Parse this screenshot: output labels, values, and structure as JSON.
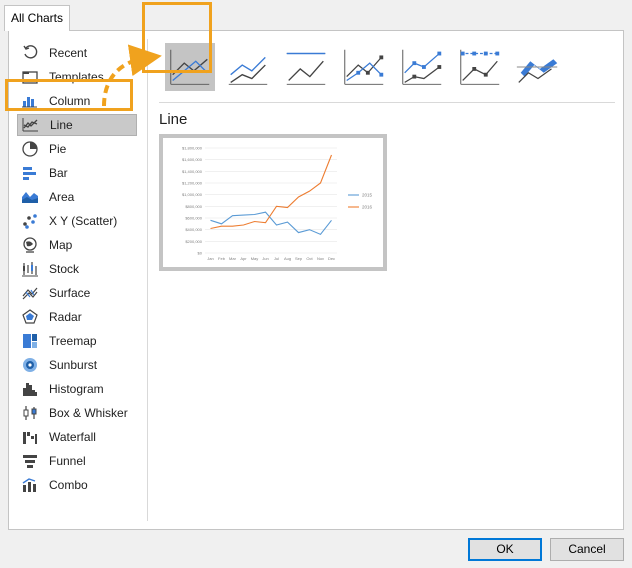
{
  "tab": {
    "label": "All Charts"
  },
  "sidebar": {
    "items": [
      {
        "label": "Recent",
        "icon": "recent-icon"
      },
      {
        "label": "Templates",
        "icon": "templates-icon"
      },
      {
        "label": "Column",
        "icon": "column-chart-icon"
      },
      {
        "label": "Line",
        "icon": "line-chart-icon",
        "selected": true
      },
      {
        "label": "Pie",
        "icon": "pie-chart-icon"
      },
      {
        "label": "Bar",
        "icon": "bar-chart-icon"
      },
      {
        "label": "Area",
        "icon": "area-chart-icon"
      },
      {
        "label": "X Y (Scatter)",
        "icon": "scatter-chart-icon"
      },
      {
        "label": "Map",
        "icon": "map-chart-icon"
      },
      {
        "label": "Stock",
        "icon": "stock-chart-icon"
      },
      {
        "label": "Surface",
        "icon": "surface-chart-icon"
      },
      {
        "label": "Radar",
        "icon": "radar-chart-icon"
      },
      {
        "label": "Treemap",
        "icon": "treemap-chart-icon"
      },
      {
        "label": "Sunburst",
        "icon": "sunburst-chart-icon"
      },
      {
        "label": "Histogram",
        "icon": "histogram-chart-icon"
      },
      {
        "label": "Box & Whisker",
        "icon": "box-whisker-chart-icon"
      },
      {
        "label": "Waterfall",
        "icon": "waterfall-chart-icon"
      },
      {
        "label": "Funnel",
        "icon": "funnel-chart-icon"
      },
      {
        "label": "Combo",
        "icon": "combo-chart-icon"
      }
    ]
  },
  "subtypes": [
    {
      "icon": "line-subtype-icon",
      "selected": true
    },
    {
      "icon": "stacked-line-subtype-icon"
    },
    {
      "icon": "100-stacked-line-subtype-icon"
    },
    {
      "icon": "line-with-markers-subtype-icon"
    },
    {
      "icon": "stacked-line-with-markers-subtype-icon"
    },
    {
      "icon": "100-stacked-line-with-markers-subtype-icon"
    },
    {
      "icon": "3d-line-subtype-icon"
    }
  ],
  "main": {
    "subtitle": "Line"
  },
  "colors": {
    "accent_highlight": "#f0a21e",
    "series_2015": "#5b9bd5",
    "series_2016": "#ed7d31"
  },
  "chart_data": {
    "type": "line",
    "categories": [
      "Jan",
      "Feb",
      "Mar",
      "Apr",
      "May",
      "Jun",
      "Jul",
      "Aug",
      "Sep",
      "Oct",
      "Nov",
      "Dec"
    ],
    "series": [
      {
        "name": "2015",
        "values": [
          560000,
          500000,
          640000,
          650000,
          660000,
          700000,
          480000,
          530000,
          350000,
          400000,
          320000,
          560000
        ]
      },
      {
        "name": "2016",
        "values": [
          420000,
          460000,
          460000,
          480000,
          540000,
          520000,
          800000,
          780000,
          960000,
          1060000,
          1200000,
          1680000
        ]
      }
    ],
    "ytick_labels": [
      "$1,800,000",
      "$1,600,000",
      "$1,400,000",
      "$1,200,000",
      "$1,000,000",
      "$800,000",
      "$600,000",
      "$400,000",
      "$200,000",
      "$0"
    ],
    "ylim": [
      0,
      1800000
    ],
    "grid": true,
    "legend": "right"
  },
  "footer": {
    "ok_label": "OK",
    "cancel_label": "Cancel"
  }
}
